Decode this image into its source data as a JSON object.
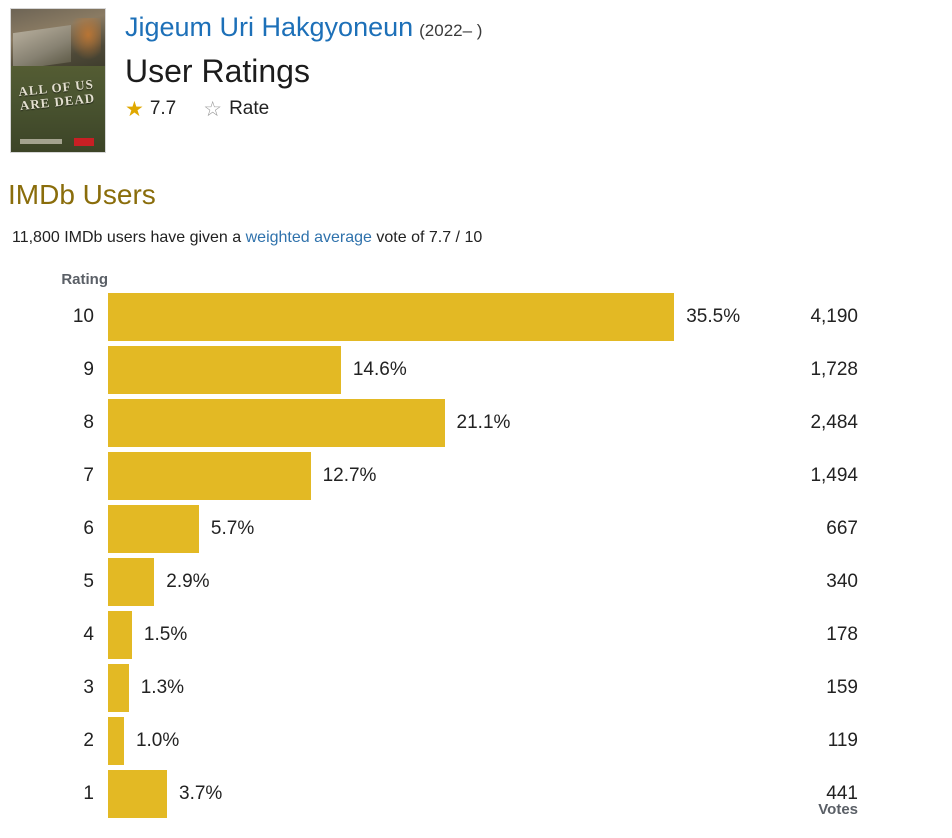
{
  "header": {
    "title_link": "Jigeum Uri Hakgyoneun",
    "year": "(2022– )",
    "page_title": "User Ratings",
    "rating_value": "7.7",
    "rate_label": "Rate",
    "star_filled_icon": "★",
    "star_hollow_icon": "☆",
    "poster_alt_text": "ALL OF US ARE DEAD"
  },
  "section": {
    "heading": "IMDb Users",
    "summary_prefix": "11,800 IMDb users have given a ",
    "summary_link": "weighted average",
    "summary_suffix": " vote of 7.7 / 10"
  },
  "table": {
    "rating_header": "Rating",
    "votes_header": "Votes"
  },
  "colors": {
    "bar": "#e3b924",
    "heading": "#8a6d0b",
    "link": "#1d70b8",
    "star": "#e0a800"
  },
  "chart_data": {
    "type": "bar",
    "title": "User Ratings",
    "xlabel": "",
    "ylabel": "Rating",
    "orientation": "horizontal",
    "grid": false,
    "legend": null,
    "xlim": [
      0,
      40
    ],
    "total_votes": "11,800",
    "weighted_average": "7.7",
    "categories": [
      "10",
      "9",
      "8",
      "7",
      "6",
      "5",
      "4",
      "3",
      "2",
      "1"
    ],
    "values": [
      35.5,
      14.6,
      21.1,
      12.7,
      5.7,
      2.9,
      1.5,
      1.3,
      1.0,
      3.7
    ],
    "percent_labels": [
      "35.5%",
      "14.6%",
      "21.1%",
      "12.7%",
      "5.7%",
      "2.9%",
      "1.5%",
      "1.3%",
      "1.0%",
      "3.7%"
    ],
    "vote_counts": [
      "4,190",
      "1,728",
      "2,484",
      "1,494",
      "667",
      "340",
      "178",
      "159",
      "119",
      "441"
    ],
    "rows": [
      {
        "rating": "10",
        "percent": "35.5%",
        "value": 35.5,
        "votes": "4,190"
      },
      {
        "rating": "9",
        "percent": "14.6%",
        "value": 14.6,
        "votes": "1,728"
      },
      {
        "rating": "8",
        "percent": "21.1%",
        "value": 21.1,
        "votes": "2,484"
      },
      {
        "rating": "7",
        "percent": "12.7%",
        "value": 12.7,
        "votes": "1,494"
      },
      {
        "rating": "6",
        "percent": "5.7%",
        "value": 5.7,
        "votes": "667"
      },
      {
        "rating": "5",
        "percent": "2.9%",
        "value": 2.9,
        "votes": "340"
      },
      {
        "rating": "4",
        "percent": "1.5%",
        "value": 1.5,
        "votes": "178"
      },
      {
        "rating": "3",
        "percent": "1.3%",
        "value": 1.3,
        "votes": "159"
      },
      {
        "rating": "2",
        "percent": "1.0%",
        "value": 1.0,
        "votes": "119"
      },
      {
        "rating": "1",
        "percent": "3.7%",
        "value": 3.7,
        "votes": "441"
      }
    ]
  }
}
